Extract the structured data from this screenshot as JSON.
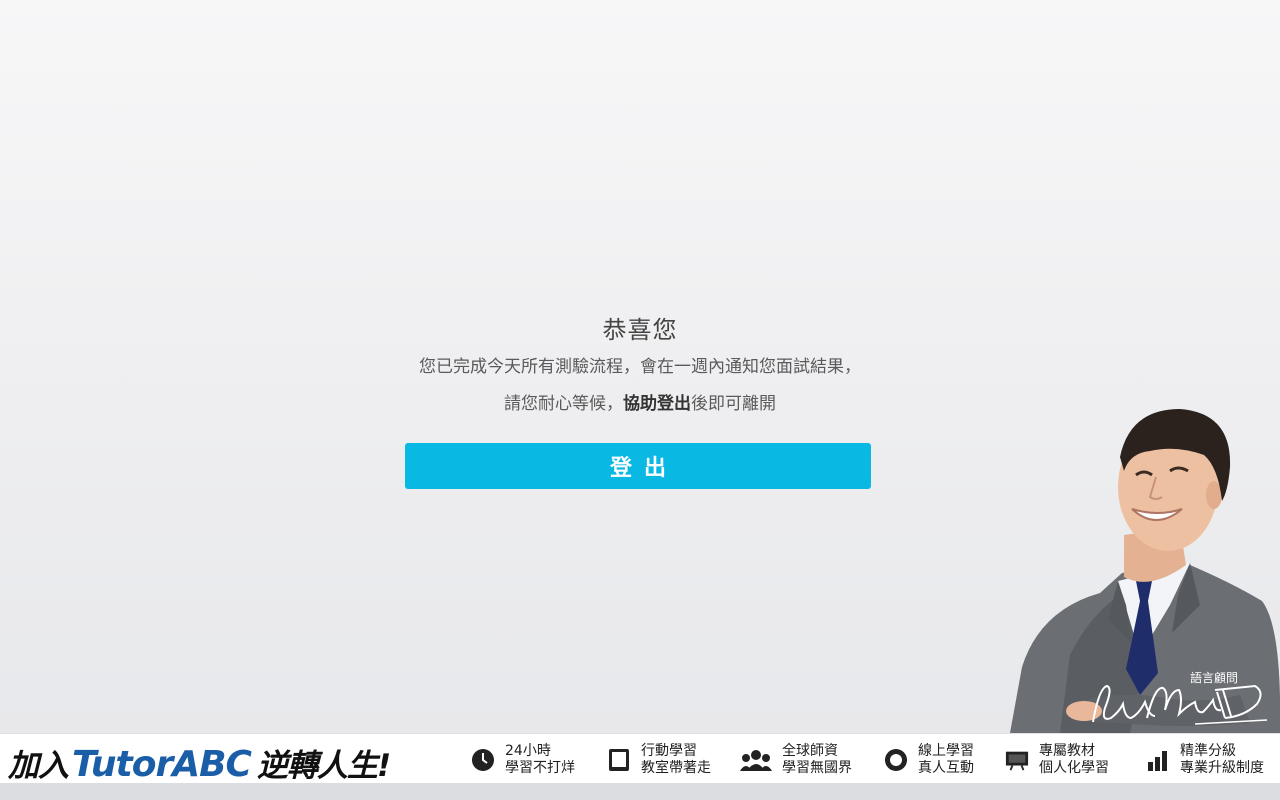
{
  "message": {
    "title": "恭喜您",
    "line1": "您已完成今天所有測驗流程，會在一週內通知您面試結果，",
    "line2_prefix": "請您耐心等候，",
    "line2_bold": "協助登出",
    "line2_suffix": "後即可離開"
  },
  "logout_button": {
    "label": "登出"
  },
  "consultant": {
    "label": "語言顧問"
  },
  "footer": {
    "slogan_prefix": "加入",
    "slogan_brand": "TutorABC",
    "slogan_suffix": "逆轉人生!",
    "features": [
      {
        "icon": "clock-icon",
        "line1": "24小時",
        "line2": "學習不打烊"
      },
      {
        "icon": "tablet-icon",
        "line1": "行動學習",
        "line2": "教室帶著走"
      },
      {
        "icon": "people-icon",
        "line1": "全球師資",
        "line2": "學習無國界"
      },
      {
        "icon": "headset-icon",
        "line1": "線上學習",
        "line2": "真人互動"
      },
      {
        "icon": "book-icon",
        "line1": "專屬教材",
        "line2": "個人化學習"
      },
      {
        "icon": "bar-chart-icon",
        "line1": "精準分級",
        "line2": "專業升級制度"
      }
    ]
  },
  "colors": {
    "button": "#0ab8e4",
    "brand_blue": "#1a5ea8"
  }
}
